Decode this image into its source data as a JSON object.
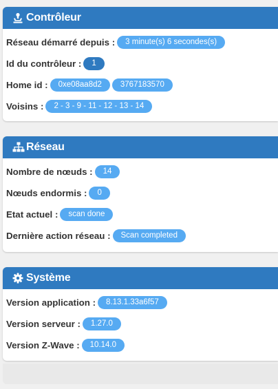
{
  "controller": {
    "title": "Contrôleur",
    "icon": "controller-icon",
    "rows": {
      "network_started": {
        "label": "Réseau démarré depuis :",
        "value": "3 minute(s) 6 secondes(s)"
      },
      "controller_id": {
        "label": "Id du contrôleur :",
        "value": "1"
      },
      "home_id": {
        "label": "Home id :",
        "value_hex": "0xe08aa8d2",
        "value_dec": "3767183570"
      },
      "neighbors": {
        "label": "Voisins :",
        "value": "2 - 3 - 9 - 11 - 12 - 13 - 14"
      }
    }
  },
  "network": {
    "title": "Réseau",
    "icon": "sitemap-icon",
    "rows": {
      "node_count": {
        "label": "Nombre de nœuds :",
        "value": "14"
      },
      "sleeping_nodes": {
        "label": "Nœuds endormis :",
        "value": "0"
      },
      "current_state": {
        "label": "Etat actuel :",
        "value": "scan done"
      },
      "last_action": {
        "label": "Dernière action réseau :",
        "value": "Scan completed"
      }
    }
  },
  "system": {
    "title": "Système",
    "icon": "gear-icon",
    "rows": {
      "app_version": {
        "label": "Version application :",
        "value": "8.13.1.33a6f57"
      },
      "server_version": {
        "label": "Version serveur :",
        "value": "1.27.0"
      },
      "zwave_version": {
        "label": "Version Z-Wave :",
        "value": "10.14.0"
      }
    }
  },
  "colors": {
    "header": "#2f7ac0",
    "badge": "#56aaf2",
    "badge_dark": "#2f7ac0",
    "background": "#f0f0f0"
  }
}
